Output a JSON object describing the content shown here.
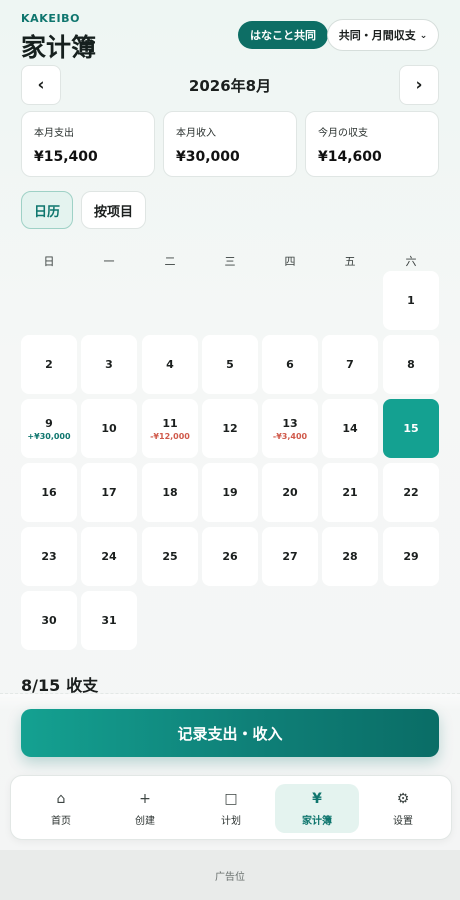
{
  "header": {
    "brand": "KAKEIBO",
    "title": "家计簿",
    "shared_badge": "はなこと共同",
    "scope_selector": "共同・月間収支",
    "scope_chevron": "⌄"
  },
  "month_nav": {
    "prev": "‹",
    "label": "2026年8月",
    "next": "›"
  },
  "summary": [
    {
      "label": "本月支出",
      "value": "¥15,400"
    },
    {
      "label": "本月收入",
      "value": "¥30,000"
    },
    {
      "label": "今月の収支",
      "value": "¥14,600"
    }
  ],
  "view_tabs": {
    "calendar": "日历",
    "by_item": "按项目",
    "active": "calendar"
  },
  "calendar": {
    "weekdays": [
      "日",
      "一",
      "二",
      "三",
      "四",
      "五",
      "六"
    ],
    "first_weekday_index": 6,
    "days_in_month": 31,
    "selected_day": 15,
    "entries": {
      "9": {
        "amount": "+¥30,000",
        "type": "income"
      },
      "11": {
        "amount": "-¥12,000",
        "type": "expense"
      },
      "13": {
        "amount": "-¥3,400",
        "type": "expense"
      }
    }
  },
  "detail": {
    "date": "8/15",
    "heading": "收支"
  },
  "cta": {
    "label": "记录支出・收入"
  },
  "bottom_nav": [
    {
      "icon": "home-icon",
      "glyph": "⌂",
      "label": "首页"
    },
    {
      "icon": "plus-icon",
      "glyph": "+",
      "label": "创建"
    },
    {
      "icon": "square-icon",
      "glyph": "□",
      "label": "计划"
    },
    {
      "icon": "yen-icon",
      "glyph": "¥",
      "label": "家计簿",
      "active": true
    },
    {
      "icon": "gear-icon",
      "glyph": "⚙",
      "label": "设置"
    }
  ],
  "ad": {
    "label": "广告位"
  },
  "colors": {
    "accent": "#0f766e",
    "selected_day": "#14a191",
    "income": "#0f766e",
    "expense": "#d05a4b"
  }
}
